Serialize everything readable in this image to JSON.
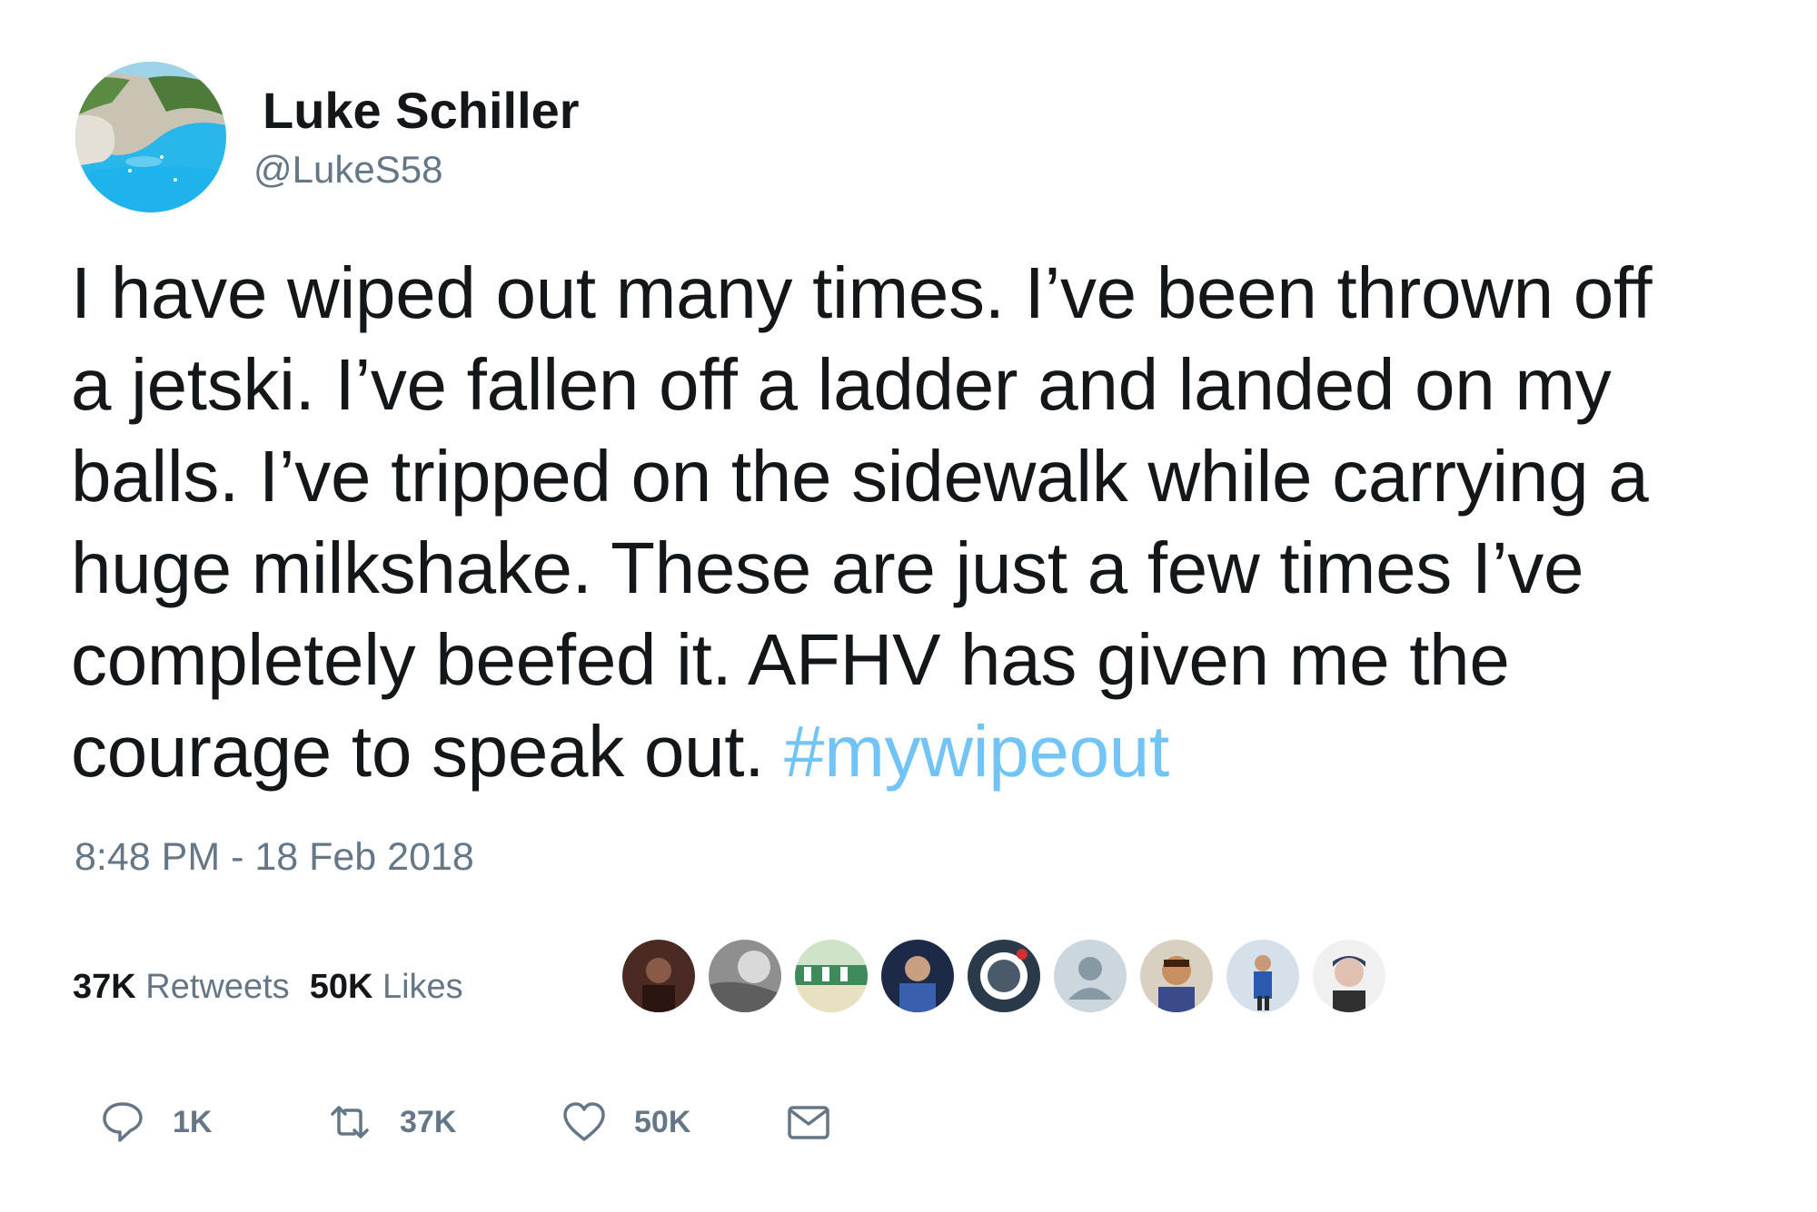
{
  "user": {
    "display_name": "Luke Schiller",
    "handle": "@LukeS58"
  },
  "tweet": {
    "lines": [
      "I have wiped out many times. I’ve been thrown off",
      "a jetski. I’ve fallen off a ladder and landed on my",
      "balls. I’ve tripped on the sidewalk while carrying a",
      "huge milkshake. These are just a few times I’ve",
      "completely beefed it. AFHV has given me the",
      "courage to speak out. "
    ],
    "hashtag": "#mywipeout",
    "timestamp": "8:48 PM - 18 Feb 2018"
  },
  "stats": {
    "retweets_count": "37K",
    "retweets_label": "Retweets",
    "likes_count": "50K",
    "likes_label": "Likes"
  },
  "actions": {
    "reply_count": "1K",
    "retweet_count": "37K",
    "like_count": "50K"
  },
  "colors": {
    "text": "#14171a",
    "secondary": "#657786",
    "hashtag": "#1da1f2"
  },
  "icons": {
    "reply": "speech-bubble-icon",
    "retweet": "retweet-arrows-icon",
    "like": "heart-icon",
    "message": "envelope-icon"
  },
  "likers_count_shown": 9
}
